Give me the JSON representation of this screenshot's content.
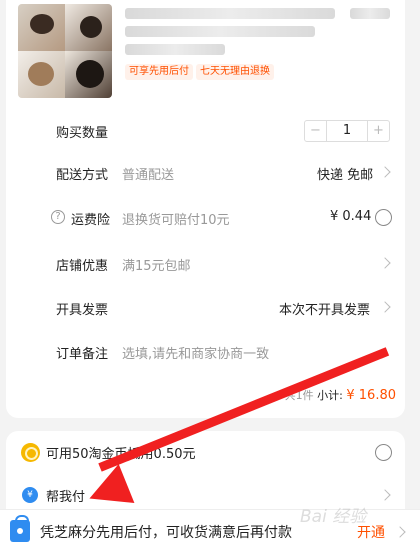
{
  "product": {
    "tags": [
      "可享先用后付",
      "七天无理由退换"
    ]
  },
  "quantity": {
    "label": "购买数量",
    "value": "1",
    "minus": "−",
    "plus": "+"
  },
  "delivery": {
    "label": "配送方式",
    "method": "普通配送",
    "value": "快递 免邮"
  },
  "freight_insurance": {
    "label": "运费险",
    "desc": "退换货可赔付10元",
    "price": "¥ 0.44",
    "help_icon": "?"
  },
  "shop_discount": {
    "label": "店铺优惠",
    "value": "满15元包邮"
  },
  "invoice": {
    "label": "开具发票",
    "value": "本次不开具发票"
  },
  "note": {
    "label": "订单备注",
    "placeholder": "选填,请先和商家协商一致"
  },
  "total": {
    "count": "共1件",
    "subtotal_label": "小计:",
    "price": "¥ 16.80"
  },
  "coins": {
    "label": "可用50淘金币抵用0.50元",
    "icon": "coin-icon"
  },
  "pay_for_me": {
    "label": "帮我付",
    "icon": "yen-icon",
    "symbol": "¥"
  },
  "banner": {
    "text": "凭芝麻分先用后付，可收货满意后再付款",
    "action": "开通",
    "icon": "bag-icon"
  },
  "watermark": "Bai 经验",
  "colors": {
    "accent": "#ff5000",
    "arrow": "#f02020",
    "blue": "#2f8cf0"
  }
}
